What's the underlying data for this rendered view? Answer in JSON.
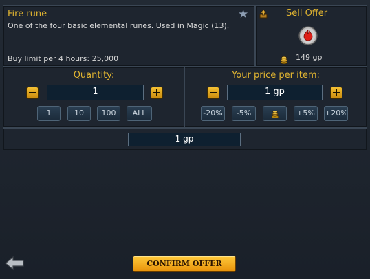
{
  "item": {
    "name": "Fire rune",
    "description": "One of the four basic elemental runes. Used in Magic (13).",
    "buy_limit": "Buy limit per 4 hours: 25,000"
  },
  "offer": {
    "title": "Sell Offer",
    "guide_price": "149 gp"
  },
  "quantity": {
    "label": "Quantity:",
    "value": "1",
    "presets": [
      "1",
      "10",
      "100",
      "ALL"
    ]
  },
  "price": {
    "label": "Your price per item:",
    "value": "1 gp",
    "adjust": [
      "-20%",
      "-5%",
      "+5%",
      "+20%"
    ]
  },
  "total": {
    "value": "1 gp"
  },
  "footer": {
    "confirm_label": "CONFIRM OFFER"
  },
  "colors": {
    "accent": "#e0b431",
    "field_bg": "#0e2030",
    "confirm_bg": "#f0a411"
  }
}
